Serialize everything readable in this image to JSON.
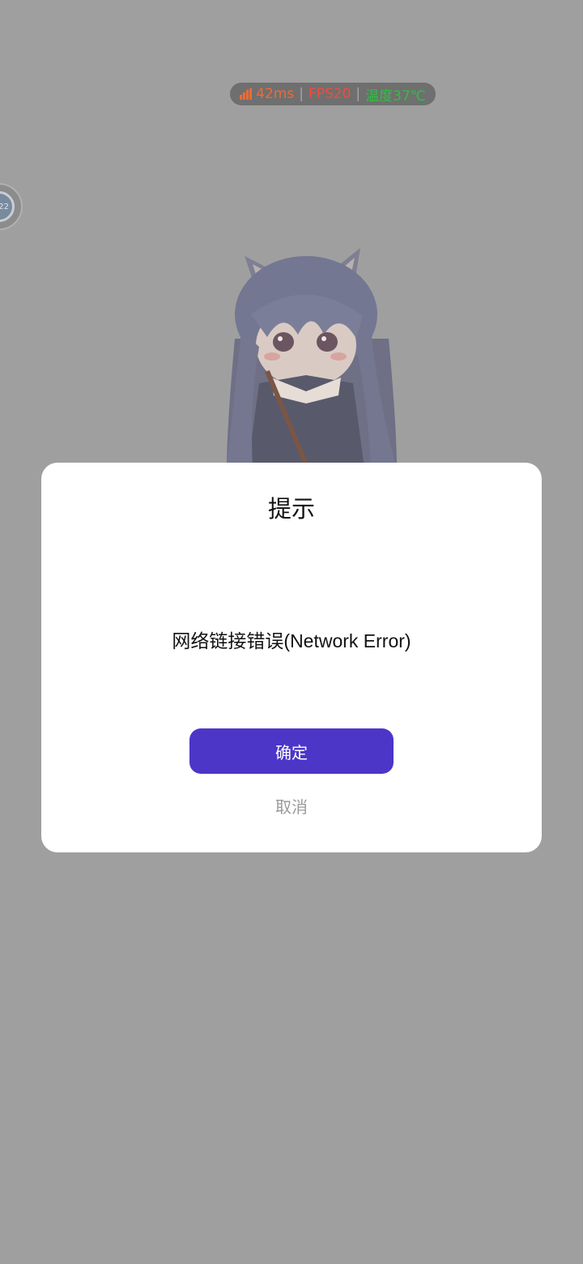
{
  "overlay": {
    "ping": "42ms",
    "fps": "FPS20",
    "temperature": "温度37℃",
    "separator": "|"
  },
  "side_bubble": {
    "text": "22"
  },
  "dialog": {
    "title": "提示",
    "message": "网络链接错误(Network Error)",
    "confirm_label": "确定",
    "cancel_label": "取消"
  },
  "colors": {
    "accent": "#4c36c8",
    "ping": "#f06a32",
    "fps": "#ef4d3e",
    "temperature": "#2fbf43",
    "backdrop": "#9f9f9f"
  }
}
